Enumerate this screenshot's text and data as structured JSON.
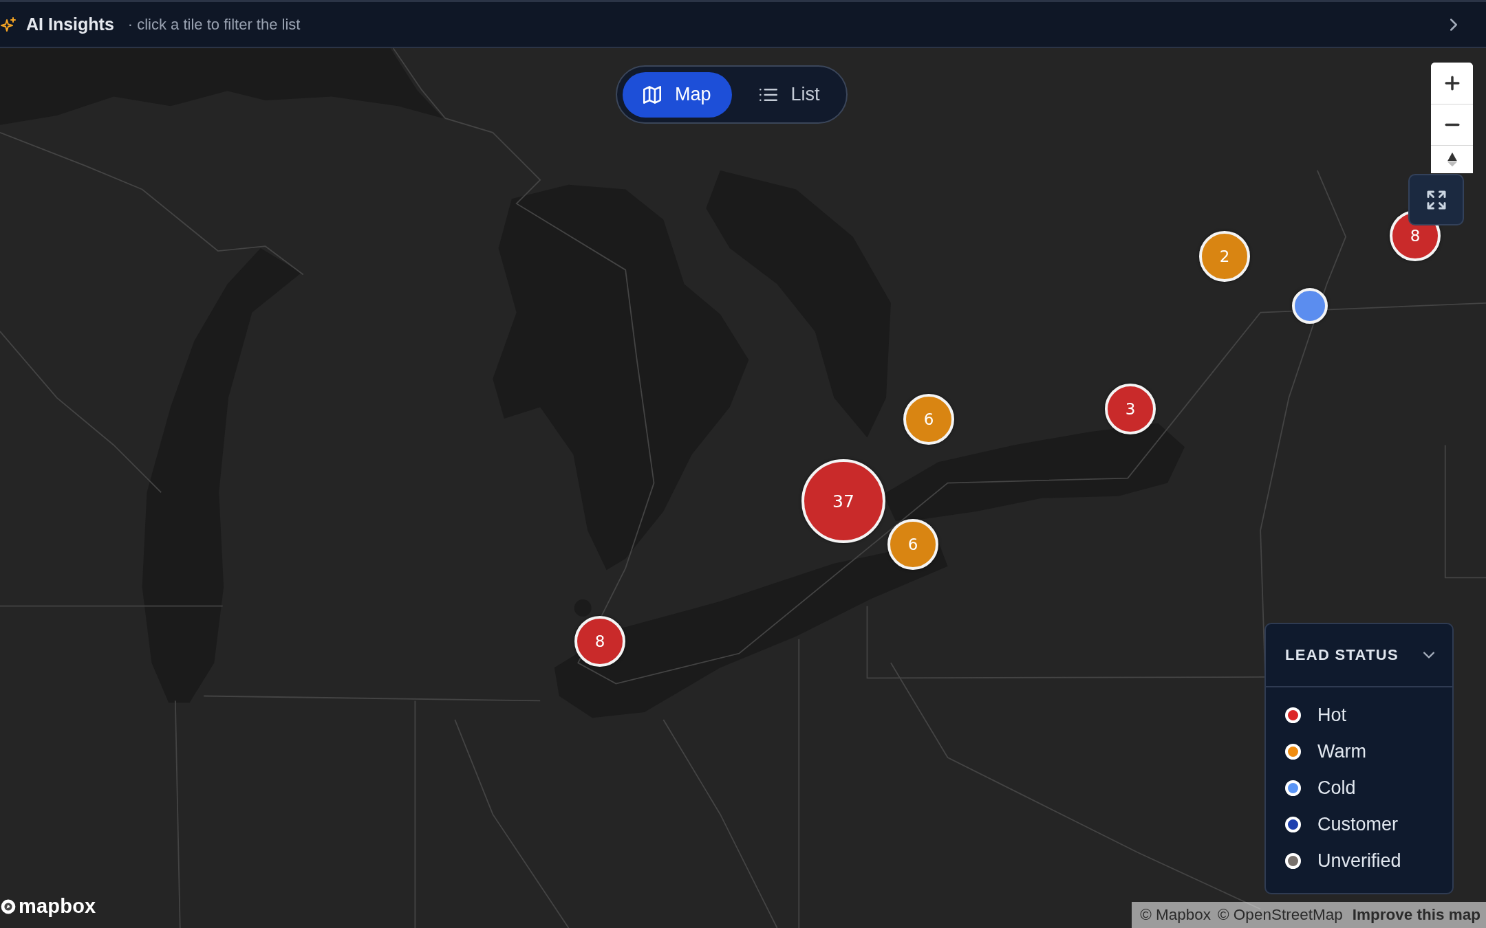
{
  "header": {
    "title": "AI Insights",
    "subtitle": "· click a tile to filter the list"
  },
  "view_toggle": [
    {
      "kind": "map",
      "label": "Map",
      "selected": true
    },
    {
      "kind": "list",
      "label": "List",
      "selected": false
    }
  ],
  "markers": [
    {
      "kind": "cluster",
      "count": "8",
      "color": "#c92a2a"
    },
    {
      "kind": "cluster",
      "count": "2",
      "color": "#d98512"
    },
    {
      "kind": "point",
      "color": "#5b8def"
    },
    {
      "kind": "cluster",
      "count": "3",
      "color": "#c92a2a"
    },
    {
      "kind": "cluster",
      "count": "6",
      "color": "#d98512"
    },
    {
      "kind": "cluster",
      "count": "37",
      "color": "#c92a2a"
    },
    {
      "kind": "cluster",
      "count": "6",
      "color": "#d98512"
    },
    {
      "kind": "cluster",
      "count": "8",
      "color": "#c92a2a"
    }
  ],
  "legend": {
    "title": "LEAD STATUS",
    "expanded": true,
    "items": [
      {
        "label": "Hot",
        "color": "#dc2626"
      },
      {
        "label": "Warm",
        "color": "#f08c0f"
      },
      {
        "label": "Cold",
        "color": "#5b95f5"
      },
      {
        "label": "Customer",
        "color": "#1e40af"
      },
      {
        "label": "Unverified",
        "color": "#78716c"
      }
    ]
  },
  "logo": {
    "text": "mapbox"
  },
  "attribution": [
    {
      "kind": "source",
      "label": "© Mapbox"
    },
    {
      "kind": "source",
      "label": "© OpenStreetMap"
    },
    {
      "kind": "feedback",
      "label": "Improve this map"
    }
  ]
}
